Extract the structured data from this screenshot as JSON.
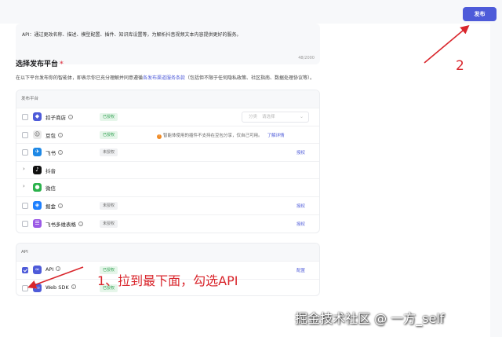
{
  "header": {
    "publish_label": "发布"
  },
  "description": {
    "text": "API：通过更改名称、描述、模型配置、插件、知识库设置等，为解析抖音视频文本内容提供更好的服务。",
    "count": "48/2000"
  },
  "platform_section": {
    "title": "选择发布平台",
    "required_mark": "*",
    "info_prefix": "在以下平台发布你的智能体，即表示你已充分理解并同意遵循",
    "info_link": "各发布渠道服务条款",
    "info_suffix": "（包括但不限于任何隐私政策、社区指南、数据处理协议等）。",
    "table_header": "发布平台",
    "rows": [
      {
        "name": "扣子商店",
        "status": "已授权",
        "category_placeholder": "分类",
        "category_value": "请选择",
        "icon_color": "#4e5bd9",
        "icon_name": "coze-store-icon",
        "glyph": "◆"
      },
      {
        "name": "豆包",
        "status": "已授权",
        "warning": "智能体使用的插件不支持在豆包分享，仅自己可用。",
        "warning_link": "了解详情",
        "icon_color": "#e9e9e9",
        "icon_name": "doubao-avatar-icon",
        "glyph": "☺"
      },
      {
        "name": "飞书",
        "status": "未授权",
        "action": "授权",
        "icon_color": "#1e88e5",
        "icon_name": "feishu-icon",
        "glyph": "✈"
      },
      {
        "name": "抖音",
        "icon_color": "#111111",
        "icon_name": "douyin-icon",
        "glyph": "♪"
      },
      {
        "name": "微信",
        "icon_color": "#2bb24c",
        "icon_name": "wechat-icon",
        "glyph": "●"
      },
      {
        "name": "掘金",
        "status": "未授权",
        "action": "授权",
        "icon_color": "#1e80ff",
        "icon_name": "juejin-icon",
        "glyph": "◈"
      },
      {
        "name": "飞书多维表格",
        "status": "未授权",
        "action": "授权",
        "icon_color": "#9b59e6",
        "icon_name": "feishu-bitable-icon",
        "glyph": "☰"
      }
    ]
  },
  "api_section": {
    "table_header": "API",
    "rows": [
      {
        "name": "API",
        "status": "已授权",
        "action": "配置",
        "checked": true,
        "icon_color": "#4e5bd9",
        "icon_name": "api-link-icon",
        "glyph": "∞"
      },
      {
        "name": "Web SDK",
        "status": "已授权",
        "checked": false,
        "icon_color": "#4e5bd9",
        "icon_name": "web-sdk-icon",
        "glyph": "▭"
      }
    ]
  },
  "annotations": {
    "step2": "2",
    "step1": "1、拉到最下面，勾选API",
    "watermark": "掘金技术社区 @ 一方_self"
  },
  "colors": {
    "accent": "#4e5bd9",
    "annotation": "#d9262c",
    "authorized": "#2a9d4b"
  }
}
